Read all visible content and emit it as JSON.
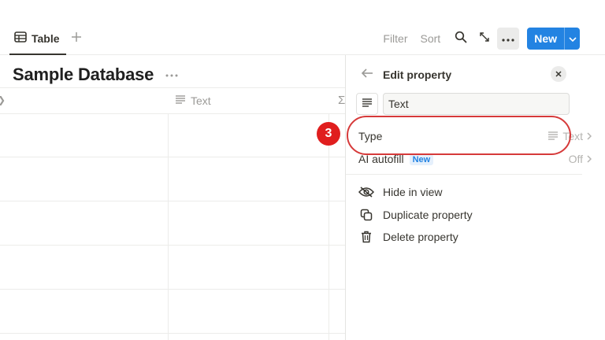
{
  "toolbar": {
    "view_tab_label": "Table",
    "filter_label": "Filter",
    "sort_label": "Sort",
    "new_label": "New"
  },
  "database": {
    "title": "Sample Database",
    "column_header": "Text",
    "row_count": 5
  },
  "panel": {
    "title": "Edit property",
    "name_value": "Text",
    "type_label": "Type",
    "type_value": "Text",
    "ai_autofill_label": "AI autofill",
    "ai_autofill_badge": "New",
    "ai_autofill_value": "Off",
    "actions": {
      "hide": "Hide in view",
      "duplicate": "Duplicate property",
      "delete": "Delete property"
    }
  },
  "annotation": {
    "step_number": "3",
    "color": "#e01e1e"
  },
  "colors": {
    "accent": "#2383e2",
    "text": "#37352f",
    "muted": "#9b9a97",
    "annotation": "#d63a3a"
  },
  "icons": {
    "view_tab": "table-icon",
    "add_view": "plus-icon",
    "search": "search-icon",
    "expand": "expand-icon",
    "more": "more-horizontal-icon",
    "new_dropdown": "chevron-down-icon",
    "back": "arrow-left-icon",
    "close": "close-icon",
    "text_type": "text-lines-icon",
    "hide": "eye-off-icon",
    "duplicate": "duplicate-icon",
    "delete": "trash-icon"
  }
}
